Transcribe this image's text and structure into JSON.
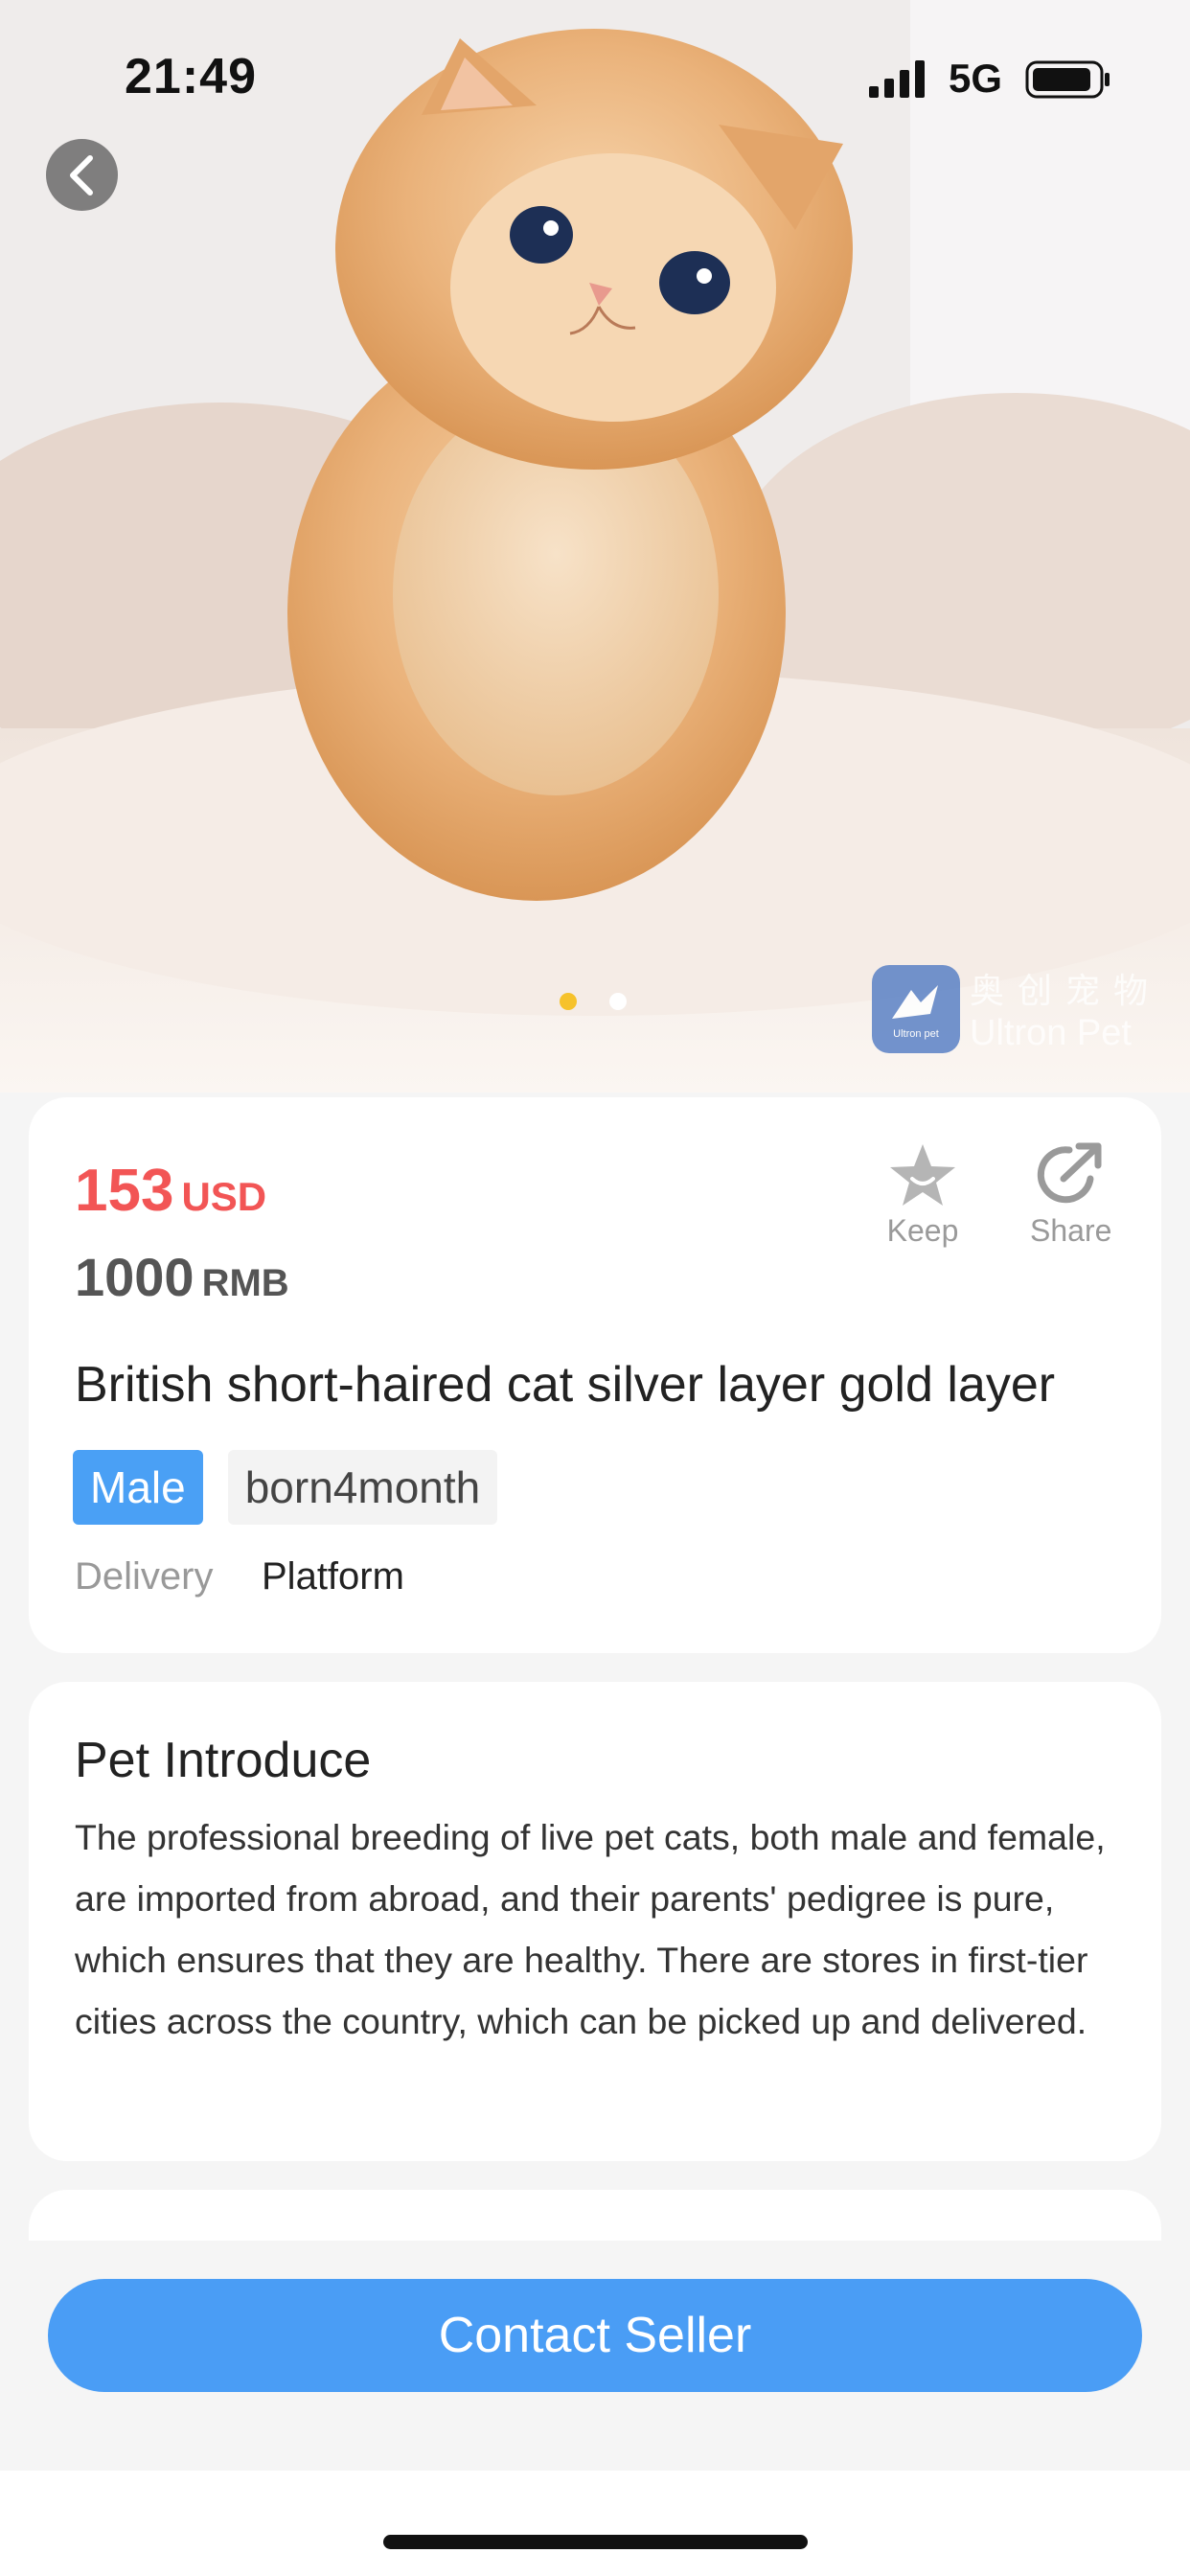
{
  "status_bar": {
    "time": "21:49",
    "network": "5G"
  },
  "hero": {
    "image": "orange-kitten-photo",
    "pager": {
      "count": 2,
      "active_index": 0,
      "active_color": "#f6c22b"
    },
    "watermark": {
      "cn": "奥创宠物",
      "en": "Ultron Pet",
      "logo_text": "Ultron pet"
    }
  },
  "product": {
    "price_usd": "153",
    "price_usd_unit": "USD",
    "price_rmb": "1000",
    "price_rmb_unit": "RMB",
    "keep_label": "Keep",
    "share_label": "Share",
    "title": "British short-haired cat silver layer gold layer",
    "tags": {
      "gender": "Male",
      "age": "born4month"
    },
    "delivery_label": "Delivery",
    "delivery_value": "Platform"
  },
  "intro": {
    "title": "Pet Introduce",
    "body": "The professional breeding of live pet cats, both male and female, are imported from abroad, and their parents' pedigree is pure, which ensures that they are healthy. There are stores in first-tier cities across the country, which can be picked up and delivered."
  },
  "actions": {
    "contact_label": "Contact Seller"
  },
  "colors": {
    "price": "#f25555",
    "accent_blue": "#4a9df5",
    "tag_blue": "#4aa0f5"
  }
}
